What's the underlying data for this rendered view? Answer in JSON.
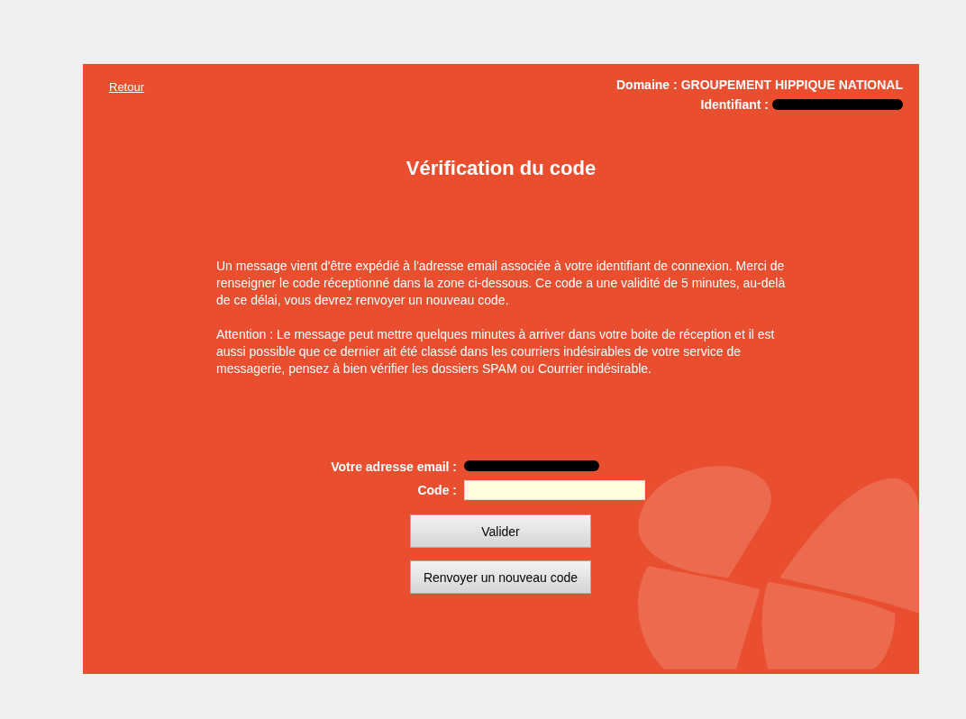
{
  "header": {
    "back_link": "Retour",
    "domain_label": "Domaine :",
    "domain_value": "GROUPEMENT HIPPIQUE NATIONAL",
    "identifier_label": "Identifiant :",
    "identifier_redacted": true
  },
  "title": "Vérification du code",
  "paragraphs": [
    "Un message vient d'être expédié à l'adresse email associée à votre identifiant de connexion. Merci de renseigner le code réceptionné dans la zone ci-dessous. Ce code a une validité de 5 minutes, au-delà de ce délai, vous devrez renvoyer un nouveau code.",
    "Attention : Le message peut mettre quelques minutes à arriver dans votre boite de réception et il est aussi possible que ce dernier ait été classé dans les courriers indésirables de votre service de messagerie, pensez à bien vérifier les dossiers SPAM ou Courrier indésirable."
  ],
  "form": {
    "email_label": "Votre adresse email :",
    "email_redacted": true,
    "code_label": "Code :"
  },
  "buttons": [
    {
      "label": "Valider"
    },
    {
      "label": "Renvoyer un nouveau code"
    }
  ]
}
